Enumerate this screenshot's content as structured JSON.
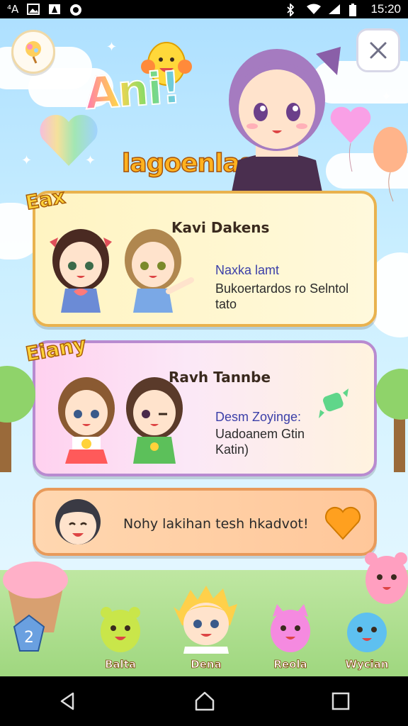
{
  "status_bar": {
    "left_text": "⁴A",
    "time": "15:20"
  },
  "header": {
    "logo_text": "Ani!",
    "subtitle": "lagoenlasa!"
  },
  "cards": [
    {
      "ribbon": "Eax",
      "title": "Kavi Dakens",
      "line1": "Naxka lamt",
      "line2": "Bukoertardos ro Selntol",
      "line3": "tato"
    },
    {
      "ribbon": "Eiany",
      "title": "Ravh Tannbe",
      "line1": "Desm Zoyinge:",
      "line2": "Uadoanem Gtin",
      "line3": "Katin)"
    }
  ],
  "message_card": {
    "text": "Nohy lakihan tesh  hkadvot!"
  },
  "bottom_nav": [
    {
      "label": "Balta"
    },
    {
      "label": "Dena"
    },
    {
      "label": "Reola"
    },
    {
      "label": "Wycian"
    }
  ],
  "icons": {
    "top_left": "lollipop-icon",
    "top_right": "close-icon",
    "back": "back-icon",
    "home": "home-icon",
    "recents": "recents-icon"
  },
  "colors": {
    "card1_border": "#e9b24e",
    "card2_border": "#b88bd0",
    "card3_border": "#e89a5a",
    "ribbon": "#ffd33a"
  }
}
